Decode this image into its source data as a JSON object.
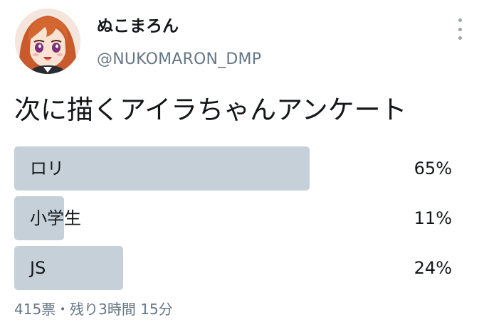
{
  "user": {
    "display_name": "ぬこまろん",
    "handle": "@NUKOMARON_DMP"
  },
  "tweet": {
    "text": "次に描くアイラちゃんアンケート"
  },
  "poll": {
    "options": [
      {
        "label": "ロリ",
        "percent_label": "65%",
        "percent": 65,
        "leading": true
      },
      {
        "label": "小学生",
        "percent_label": "11%",
        "percent": 11,
        "leading": false
      },
      {
        "label": "JS",
        "percent_label": "24%",
        "percent": 24,
        "leading": false
      }
    ],
    "footer": "415票・残り3時間 15分"
  },
  "icons": {
    "avatar": "anime-girl-avatar",
    "more": "vertical-dots-icon"
  },
  "colors": {
    "bar": "#c5d0d9",
    "text": "#14171a",
    "muted": "#657786"
  }
}
